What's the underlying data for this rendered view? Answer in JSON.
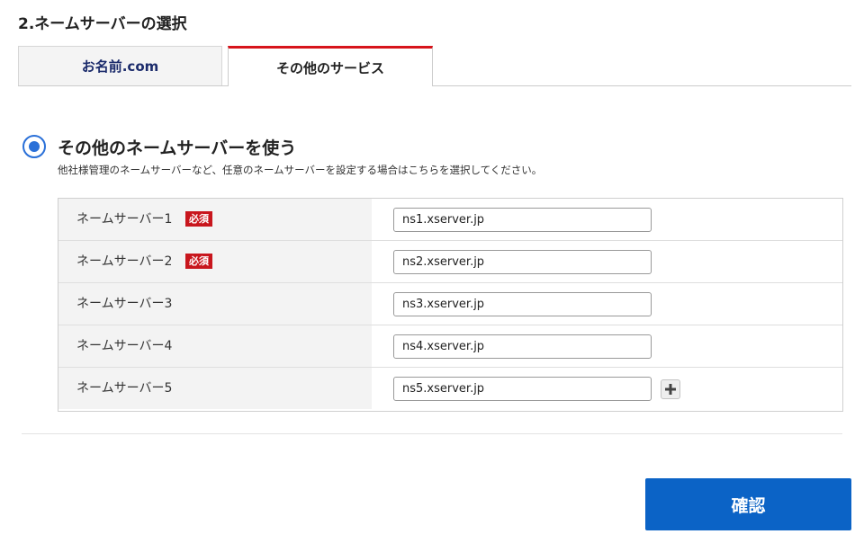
{
  "section": {
    "title": "2.ネームサーバーの選択"
  },
  "tabs": [
    {
      "label": "お名前.com",
      "active": false
    },
    {
      "label": "その他のサービス",
      "active": true
    }
  ],
  "option": {
    "title": "その他のネームサーバーを使う",
    "description": "他社様管理のネームサーバーなど、任意のネームサーバーを設定する場合はこちらを選択してください。",
    "selected": true
  },
  "nameservers": [
    {
      "label": "ネームサーバー1",
      "required_badge": "必須",
      "value": "ns1.xserver.jp"
    },
    {
      "label": "ネームサーバー2",
      "required_badge": "必須",
      "value": "ns2.xserver.jp"
    },
    {
      "label": "ネームサーバー3",
      "value": "ns3.xserver.jp"
    },
    {
      "label": "ネームサーバー4",
      "value": "ns4.xserver.jp"
    },
    {
      "label": "ネームサーバー5",
      "value": "ns5.xserver.jp"
    }
  ],
  "confirm_label": "確認",
  "colors": {
    "accent": "#0b63c6",
    "required": "#c8161d",
    "tab_active_border": "#d7141b",
    "radio": "#2a70d8"
  }
}
